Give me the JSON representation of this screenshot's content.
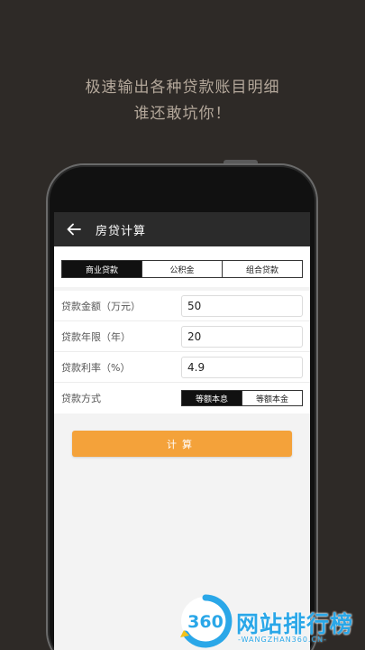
{
  "tagline": {
    "line1": "极速输出各种贷款账目明细",
    "line2": "谁还敢坑你！"
  },
  "appbar": {
    "title": "房贷计算",
    "back_icon": "arrow-left-icon"
  },
  "tabs": [
    {
      "label": "商业贷款",
      "active": true
    },
    {
      "label": "公积金",
      "active": false
    },
    {
      "label": "组合贷款",
      "active": false
    }
  ],
  "form": {
    "amount": {
      "label": "贷款金额（万元）",
      "value": "50"
    },
    "years": {
      "label": "贷款年限（年）",
      "value": "20"
    },
    "rate": {
      "label": "贷款利率（%）",
      "value": "4.9"
    },
    "method": {
      "label": "贷款方式",
      "options": [
        {
          "label": "等额本息",
          "active": true
        },
        {
          "label": "等额本金",
          "active": false
        }
      ]
    }
  },
  "calc_button": {
    "label": "计算"
  },
  "watermark": {
    "logo": "360",
    "text": "网站排行榜",
    "sub": "-WANGZHAN360.CN-"
  },
  "colors": {
    "accent": "#f4a23a",
    "appbar": "#2b2b2b",
    "background": "#2e2a27",
    "watermark": "#2aa7e8"
  }
}
